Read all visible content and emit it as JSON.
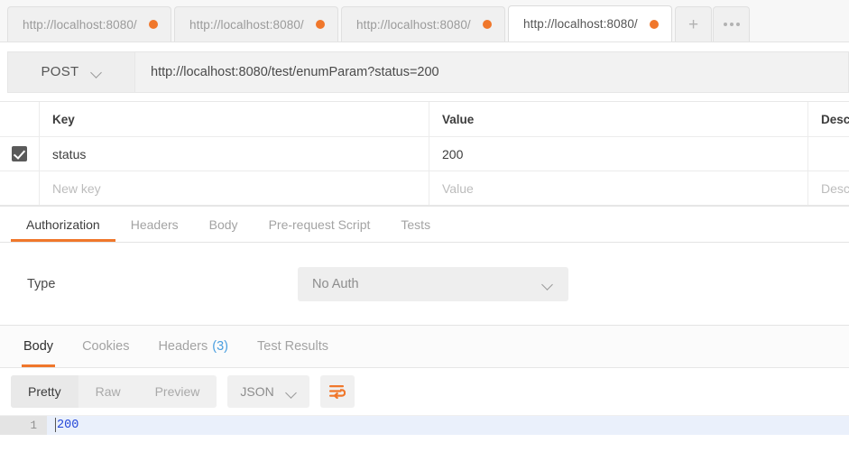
{
  "tabbar": {
    "tabs": [
      {
        "label": "http://localhost:8080/",
        "active": false
      },
      {
        "label": "http://localhost:8080/",
        "active": false
      },
      {
        "label": "http://localhost:8080/",
        "active": false
      },
      {
        "label": "http://localhost:8080/",
        "active": true
      }
    ],
    "new_tab_label": "+",
    "more_label": "•••",
    "dot_color": "#f0772b"
  },
  "request": {
    "method": "POST",
    "url": "http://localhost:8080/test/enumParam?status=200"
  },
  "params_table": {
    "headers": {
      "key": "Key",
      "value": "Value",
      "description": "Descr"
    },
    "rows": [
      {
        "checked": true,
        "key": "status",
        "value": "200",
        "description": ""
      }
    ],
    "new_row": {
      "key_placeholder": "New key",
      "value_placeholder": "Value",
      "description_placeholder": "Desc"
    }
  },
  "request_tabs": {
    "items": [
      {
        "label": "Authorization",
        "active": true
      },
      {
        "label": "Headers",
        "active": false
      },
      {
        "label": "Body",
        "active": false
      },
      {
        "label": "Pre-request Script",
        "active": false
      },
      {
        "label": "Tests",
        "active": false
      }
    ],
    "accent_color": "#f0772b"
  },
  "authorization": {
    "type_label": "Type",
    "type_value": "No Auth"
  },
  "response_tabs": {
    "items": [
      {
        "label": "Body",
        "count": "",
        "active": true
      },
      {
        "label": "Cookies",
        "count": "",
        "active": false
      },
      {
        "label": "Headers",
        "count": "(3)",
        "active": false
      },
      {
        "label": "Test Results",
        "count": "",
        "active": false
      }
    ],
    "count_color": "#4a9fe0"
  },
  "response_toolbar": {
    "view_modes": [
      {
        "label": "Pretty",
        "active": true
      },
      {
        "label": "Raw",
        "active": false
      },
      {
        "label": "Preview",
        "active": false
      }
    ],
    "format": "JSON",
    "wrap_icon": "word-wrap-icon",
    "wrap_icon_color": "#f0772b"
  },
  "response_body": {
    "lines": [
      {
        "number": "1",
        "text": "200"
      }
    ]
  }
}
